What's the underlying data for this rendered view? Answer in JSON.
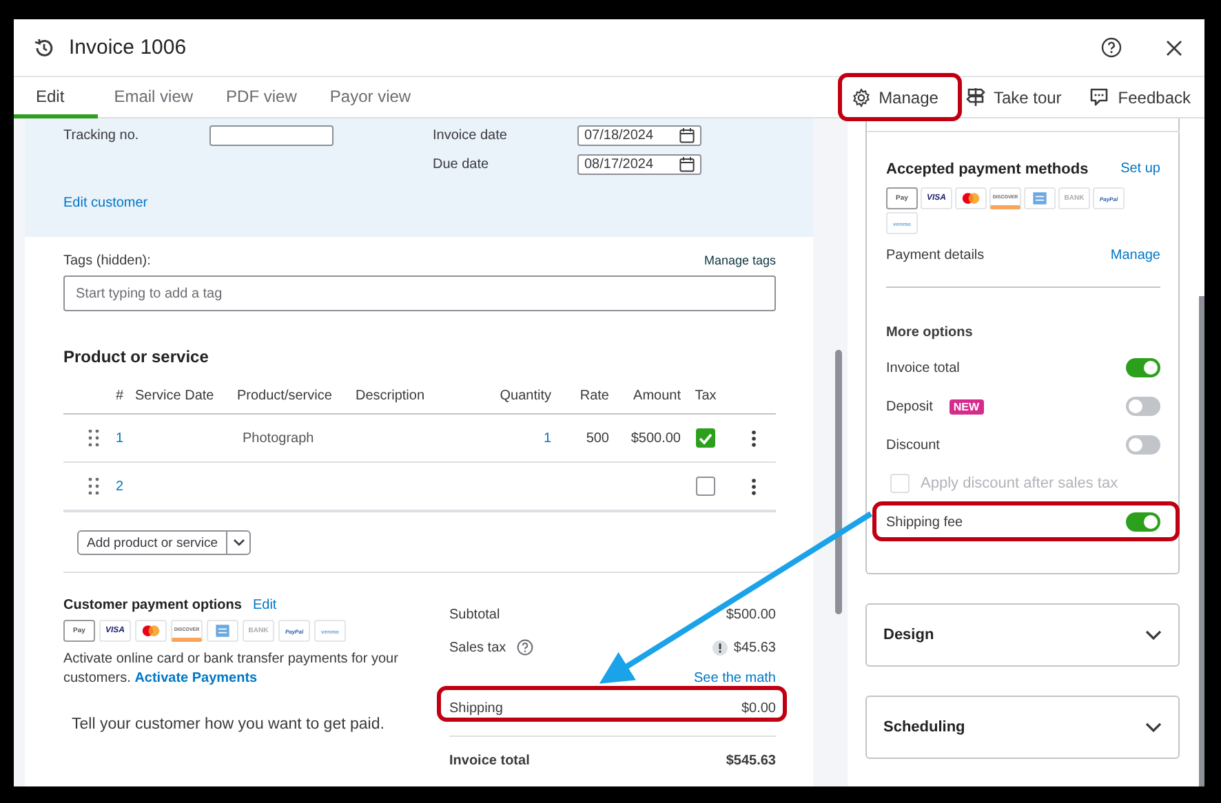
{
  "window": {
    "title": "Invoice 1006"
  },
  "tabs": [
    {
      "label": "Edit",
      "selected": true
    },
    {
      "label": "Email view",
      "selected": false
    },
    {
      "label": "PDF view",
      "selected": false
    },
    {
      "label": "Payor view",
      "selected": false
    }
  ],
  "toolbar": [
    {
      "kind": "manage",
      "label": "Manage"
    },
    {
      "kind": "tour",
      "label": "Take tour"
    },
    {
      "kind": "feedback",
      "label": "Feedback"
    }
  ],
  "customer": {
    "fields": [
      {
        "label": "Tracking no."
      },
      {
        "label": "Invoice date",
        "value": "07/18/2024"
      },
      {
        "label": "Due date",
        "value": "08/17/2024"
      }
    ],
    "edit_link": "Edit customer"
  },
  "tags": {
    "label": "Tags (hidden):",
    "link": "Manage tags",
    "placeholder": "Start typing to add a tag"
  },
  "products": {
    "title": "Product or service",
    "columns": [
      "#",
      "Service Date",
      "Product/service",
      "Description",
      "Quantity",
      "Rate",
      "Amount",
      "Tax"
    ],
    "rows": [
      {
        "number": "1",
        "product": "Photograph",
        "quantity": "1",
        "rate": "500",
        "amount": "$500.00",
        "tax": true
      },
      {
        "number": "2",
        "tax": false
      }
    ],
    "add_button": "Add product or service"
  },
  "payment_options": {
    "title": "Customer payment options",
    "edit": "Edit",
    "methods": [
      {
        "kind": "applepay",
        "label": "Pay"
      },
      {
        "kind": "visa",
        "label": "VISA"
      },
      {
        "kind": "mastercard"
      },
      {
        "kind": "discover",
        "label": "DISCOVER"
      },
      {
        "kind": "amex"
      },
      {
        "kind": "bank",
        "label": "BANK"
      },
      {
        "kind": "paypal",
        "label": "PayPal"
      },
      {
        "kind": "venmo",
        "label": "venmo"
      }
    ],
    "text": "Activate online card or bank transfer payments for your customers.",
    "link": "Activate Payments",
    "note": "Tell your customer how you want to get paid."
  },
  "totals": [
    {
      "kind": "line",
      "label": "Subtotal",
      "value": "$500.00"
    },
    {
      "kind": "tax",
      "label": "Sales tax",
      "value": "$45.63",
      "link": "See the math"
    },
    {
      "kind": "line",
      "label": "Shipping",
      "value": "$0.00"
    },
    {
      "kind": "total",
      "label": "Invoice total",
      "value": "$545.63"
    }
  ],
  "payments_card": {
    "title": "Accepted payment methods",
    "link": "Set up",
    "methods": [
      {
        "kind": "applepay",
        "label": "Pay"
      },
      {
        "kind": "visa",
        "label": "VISA"
      },
      {
        "kind": "mastercard"
      },
      {
        "kind": "discover",
        "label": "DISCOVER"
      },
      {
        "kind": "amex"
      },
      {
        "kind": "bank",
        "label": "BANK"
      },
      {
        "kind": "paypal",
        "label": "PayPal"
      },
      {
        "kind": "venmo",
        "label": "venmo"
      }
    ],
    "details_label": "Payment details",
    "details_link": "Manage"
  },
  "more_options": {
    "title": "More options",
    "items": [
      {
        "kind": "toggle",
        "label": "Invoice total",
        "on": true
      },
      {
        "kind": "toggle",
        "label": "Deposit",
        "badge": "NEW",
        "on": false
      },
      {
        "kind": "toggle",
        "label": "Discount",
        "on": false
      },
      {
        "kind": "checkbox",
        "label": "Apply discount after sales tax",
        "checked": false,
        "disabled": true
      },
      {
        "kind": "toggle",
        "label": "Shipping fee",
        "on": true
      }
    ]
  },
  "sections": [
    {
      "title": "Design",
      "expanded": false
    },
    {
      "title": "Scheduling",
      "expanded": false
    }
  ]
}
